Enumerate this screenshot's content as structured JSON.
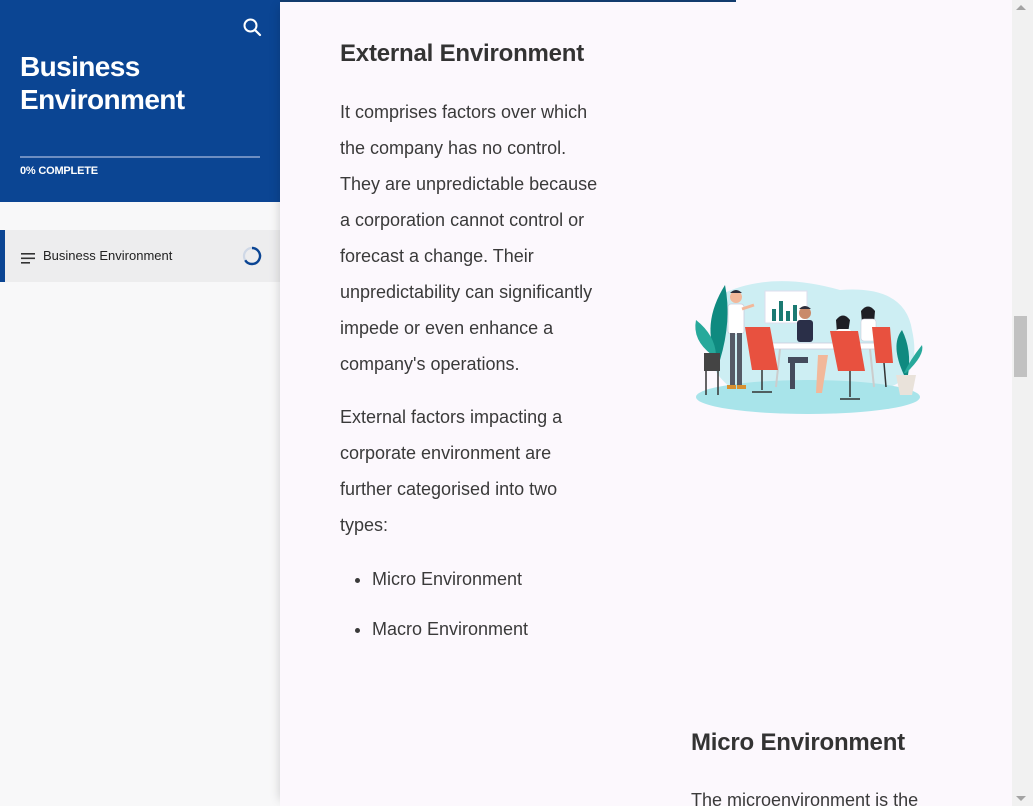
{
  "sidebar": {
    "course_title": "Business Environment",
    "progress_percent": 0,
    "progress_label": "0% COMPLETE",
    "search_icon": "search-icon",
    "lessons": [
      {
        "label": "Business Environment",
        "icon": "lines-icon",
        "status_icon": "in-progress-ring-icon"
      }
    ]
  },
  "content": {
    "external": {
      "heading": "External Environment",
      "para1_lines": [
        "It comprises factors over which",
        "the company has no control.",
        "They are unpredictable because",
        "a corporation cannot control or",
        "forecast a change. Their",
        "unpredictability can significantly",
        "impede or even enhance a",
        "company's operations."
      ],
      "para2_lines": [
        "External factors impacting a",
        "corporate environment are",
        "further categorised into two",
        "types:"
      ],
      "types": [
        "Micro Environment",
        "Macro Environment"
      ]
    },
    "micro": {
      "heading": "Micro Environment",
      "para_lines": [
        "The microenvironment is the"
      ]
    }
  },
  "colors": {
    "brand": "#0b4593",
    "main_bg": "#fcf8fd",
    "sidebar_bg": "#f8f8f9"
  }
}
